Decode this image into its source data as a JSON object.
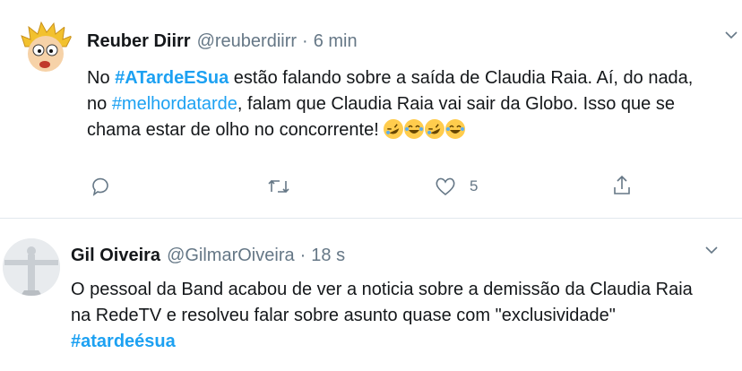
{
  "tweets": [
    {
      "name": "Reuber Diirr",
      "handle": "@reuberdiirr",
      "separator": "·",
      "time": "6 min",
      "text": {
        "line1_pre": "No ",
        "hashtag1": "#ATardeESua",
        "line1_post": " estão falando sobre a saída de Claudia Raia. Aí, do nada,",
        "line2_pre": "no ",
        "hashtag2": "#melhordatarde",
        "line2_post": ", falam que Claudia Raia vai sair da Globo. Isso que se",
        "line3": "chama estar de olho no concorrente!"
      },
      "emojis": [
        "rofl",
        "joy",
        "rofl",
        "joy"
      ],
      "actions": {
        "reply_icon": "reply-icon",
        "retweet_icon": "retweet-icon",
        "like_icon": "heart-icon",
        "like_count": "5",
        "share_icon": "share-icon"
      }
    },
    {
      "name": "Gil Oiveira",
      "handle": "@GilmarOiveira",
      "separator": "·",
      "time": "18 s",
      "text": {
        "line1": "O pessoal da Band acabou de ver a noticia sobre a demissão da Claudia Raia",
        "line2": "na RedeTV e resolveu falar sobre asunto quase com \"exclusividade\"",
        "hashtag": "#atardeésua"
      }
    }
  ],
  "colors": {
    "link": "#1da1f2",
    "muted": "#657786",
    "text": "#14171a",
    "divider": "#e1e8ed"
  }
}
